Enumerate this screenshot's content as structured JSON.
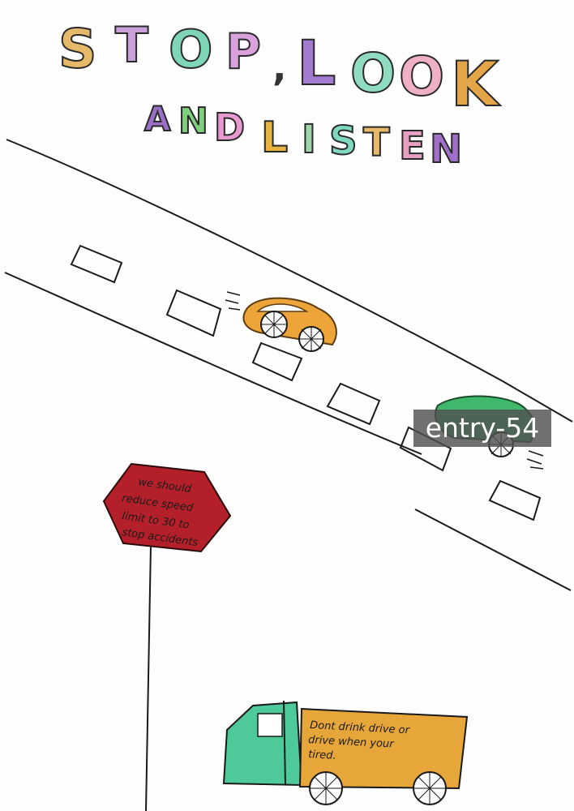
{
  "title": {
    "line1": [
      "S",
      "T",
      "O",
      "P",
      ",",
      "L",
      "O",
      "O",
      "K"
    ],
    "line2": [
      "A",
      "N",
      "D",
      "L",
      "I",
      "S",
      "T",
      "E",
      "N"
    ],
    "colors1": [
      "#e5b86a",
      "#c9a0d8",
      "#7fd6b6",
      "#d9a2dc",
      "#333333",
      "#a27ad0",
      "#8fdcc0",
      "#f0b0c4",
      "#e3a548"
    ],
    "colors2": [
      "#9c6fc7",
      "#7fd07e",
      "#e89ad0",
      "#e6b53f",
      "#9fd8a8",
      "#7fd8c0",
      "#e6b868",
      "#e9a0c4",
      "#a070c8"
    ]
  },
  "sign": {
    "text": "we should reduce speed limit to 30 to stop accidents",
    "color": "#b3202a"
  },
  "truck": {
    "text": "Dont drink drive or drive when your tired.",
    "cab_color": "#4ec99a",
    "box_color": "#e7a63a"
  },
  "cars": {
    "orange_color": "#eda53a",
    "green_color": "#3fb86b"
  },
  "watermark": "entry-54"
}
